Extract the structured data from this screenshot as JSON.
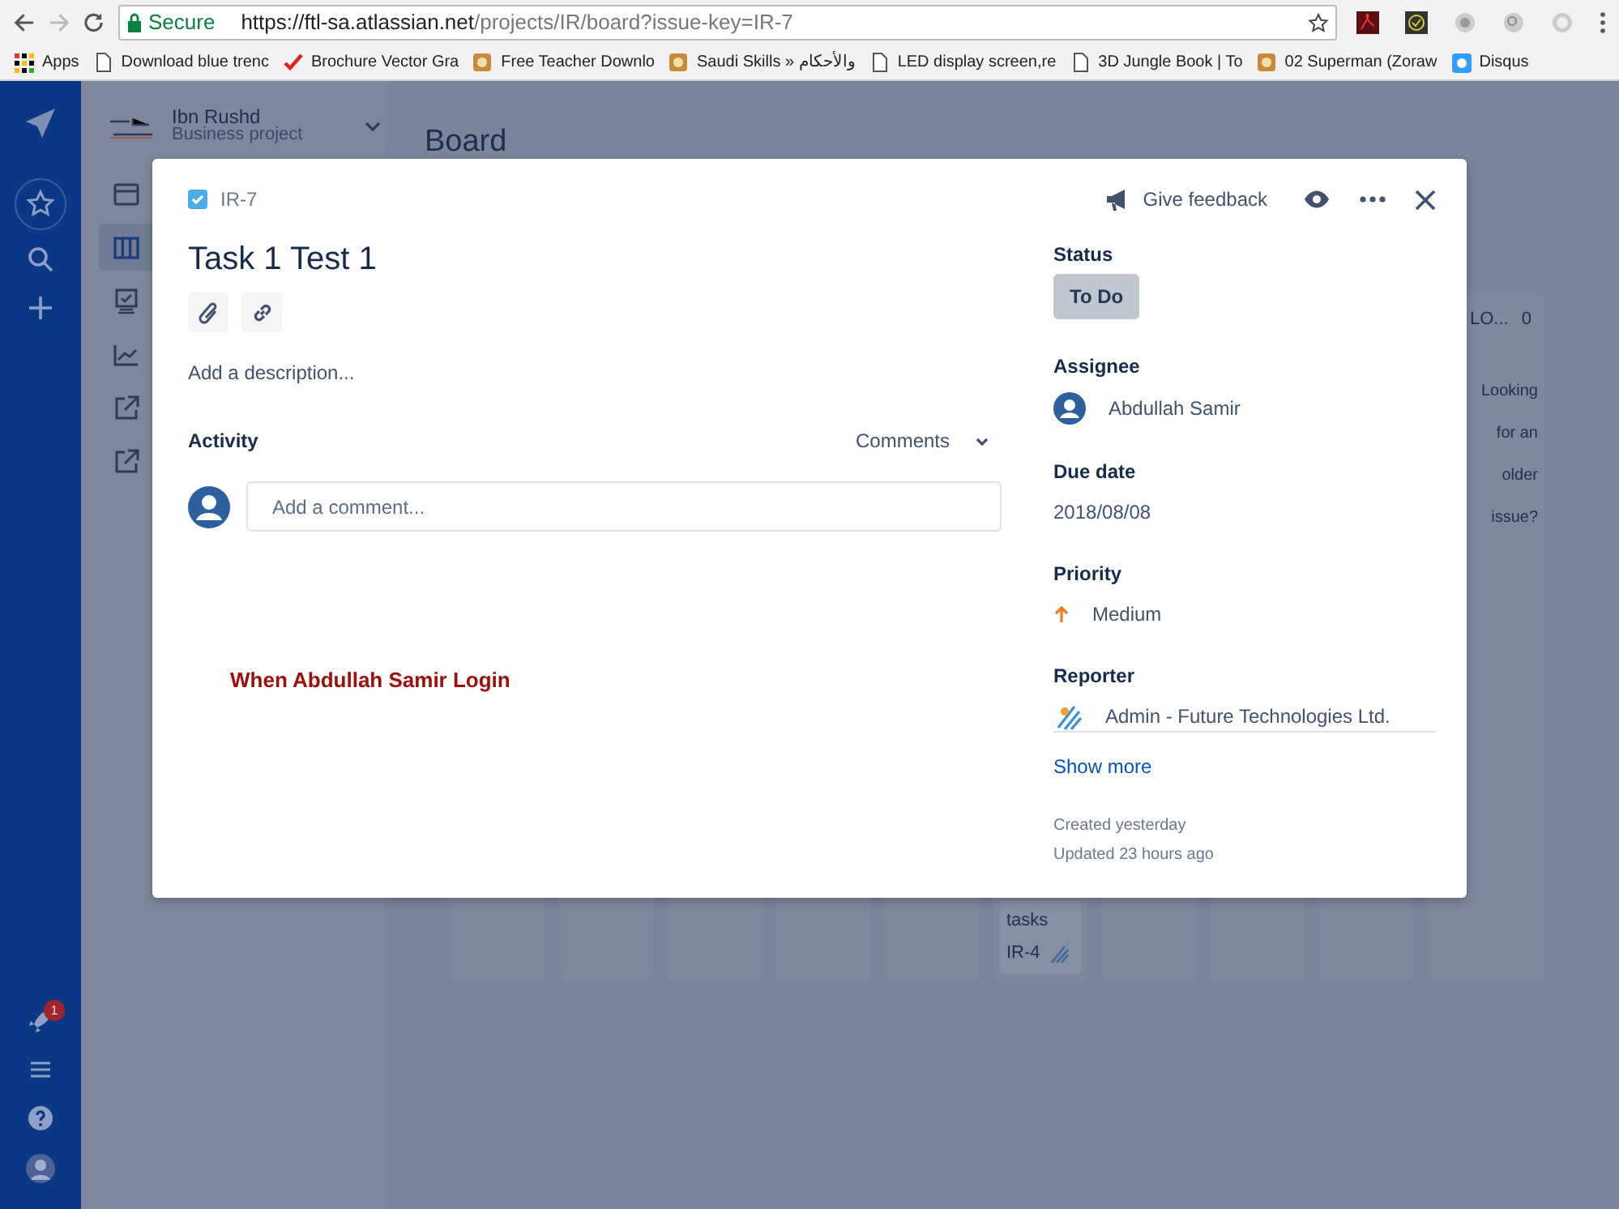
{
  "browser": {
    "secure_label": "Secure",
    "url_host": "https://ftl-sa.atlassian.net",
    "url_path": "/projects/IR/board?issue-key=IR-7",
    "bookmarks": [
      {
        "kind": "apps",
        "label": "Apps"
      },
      {
        "kind": "page",
        "label": "Download blue trenc"
      },
      {
        "kind": "check",
        "label": "Brochure Vector Gra"
      },
      {
        "kind": "image",
        "label": "Free Teacher Downlo"
      },
      {
        "kind": "image",
        "label": "Saudi Skills » والأحكام"
      },
      {
        "kind": "page",
        "label": "LED display screen,re"
      },
      {
        "kind": "page",
        "label": "3D Jungle Book | To"
      },
      {
        "kind": "image",
        "label": "02 Superman (Zoraw"
      },
      {
        "kind": "disqus",
        "label": "Disqus"
      }
    ]
  },
  "global_nav": {
    "notification_count": "1"
  },
  "project": {
    "name": "Ibn Rushd",
    "type": "Business project",
    "nav": [
      {
        "kind": "window",
        "selected": false
      },
      {
        "kind": "board",
        "selected": true
      },
      {
        "kind": "monitor",
        "selected": false
      },
      {
        "kind": "chart",
        "selected": false
      },
      {
        "kind": "external",
        "selected": false
      },
      {
        "kind": "external",
        "selected": false
      }
    ]
  },
  "board": {
    "title": "Board",
    "column_header": "LO...",
    "column_count": "0",
    "hint": "Looking for an older issue?",
    "card_text": "tasks",
    "card_key": "IR-4"
  },
  "issue": {
    "key": "IR-7",
    "feedback": "Give feedback",
    "title": "Task 1 Test 1",
    "description_placeholder": "Add a description...",
    "activity": "Activity",
    "activity_filter": "Comments",
    "comment_placeholder": "Add a comment...",
    "fields": [
      {
        "kind": "status",
        "label": "Status",
        "value": "To Do"
      },
      {
        "kind": "user",
        "label": "Assignee",
        "value": "Abdullah Samir"
      },
      {
        "kind": "text",
        "label": "Due date",
        "value": "2018/08/08"
      },
      {
        "kind": "priority",
        "label": "Priority",
        "value": "Medium"
      },
      {
        "kind": "org",
        "label": "Reporter",
        "value": "Admin - Future Technologies Ltd."
      }
    ],
    "show_more": "Show more",
    "created": "Created yesterday",
    "updated": "Updated 23 hours ago"
  },
  "annotation": "When Abdullah Samir Login"
}
